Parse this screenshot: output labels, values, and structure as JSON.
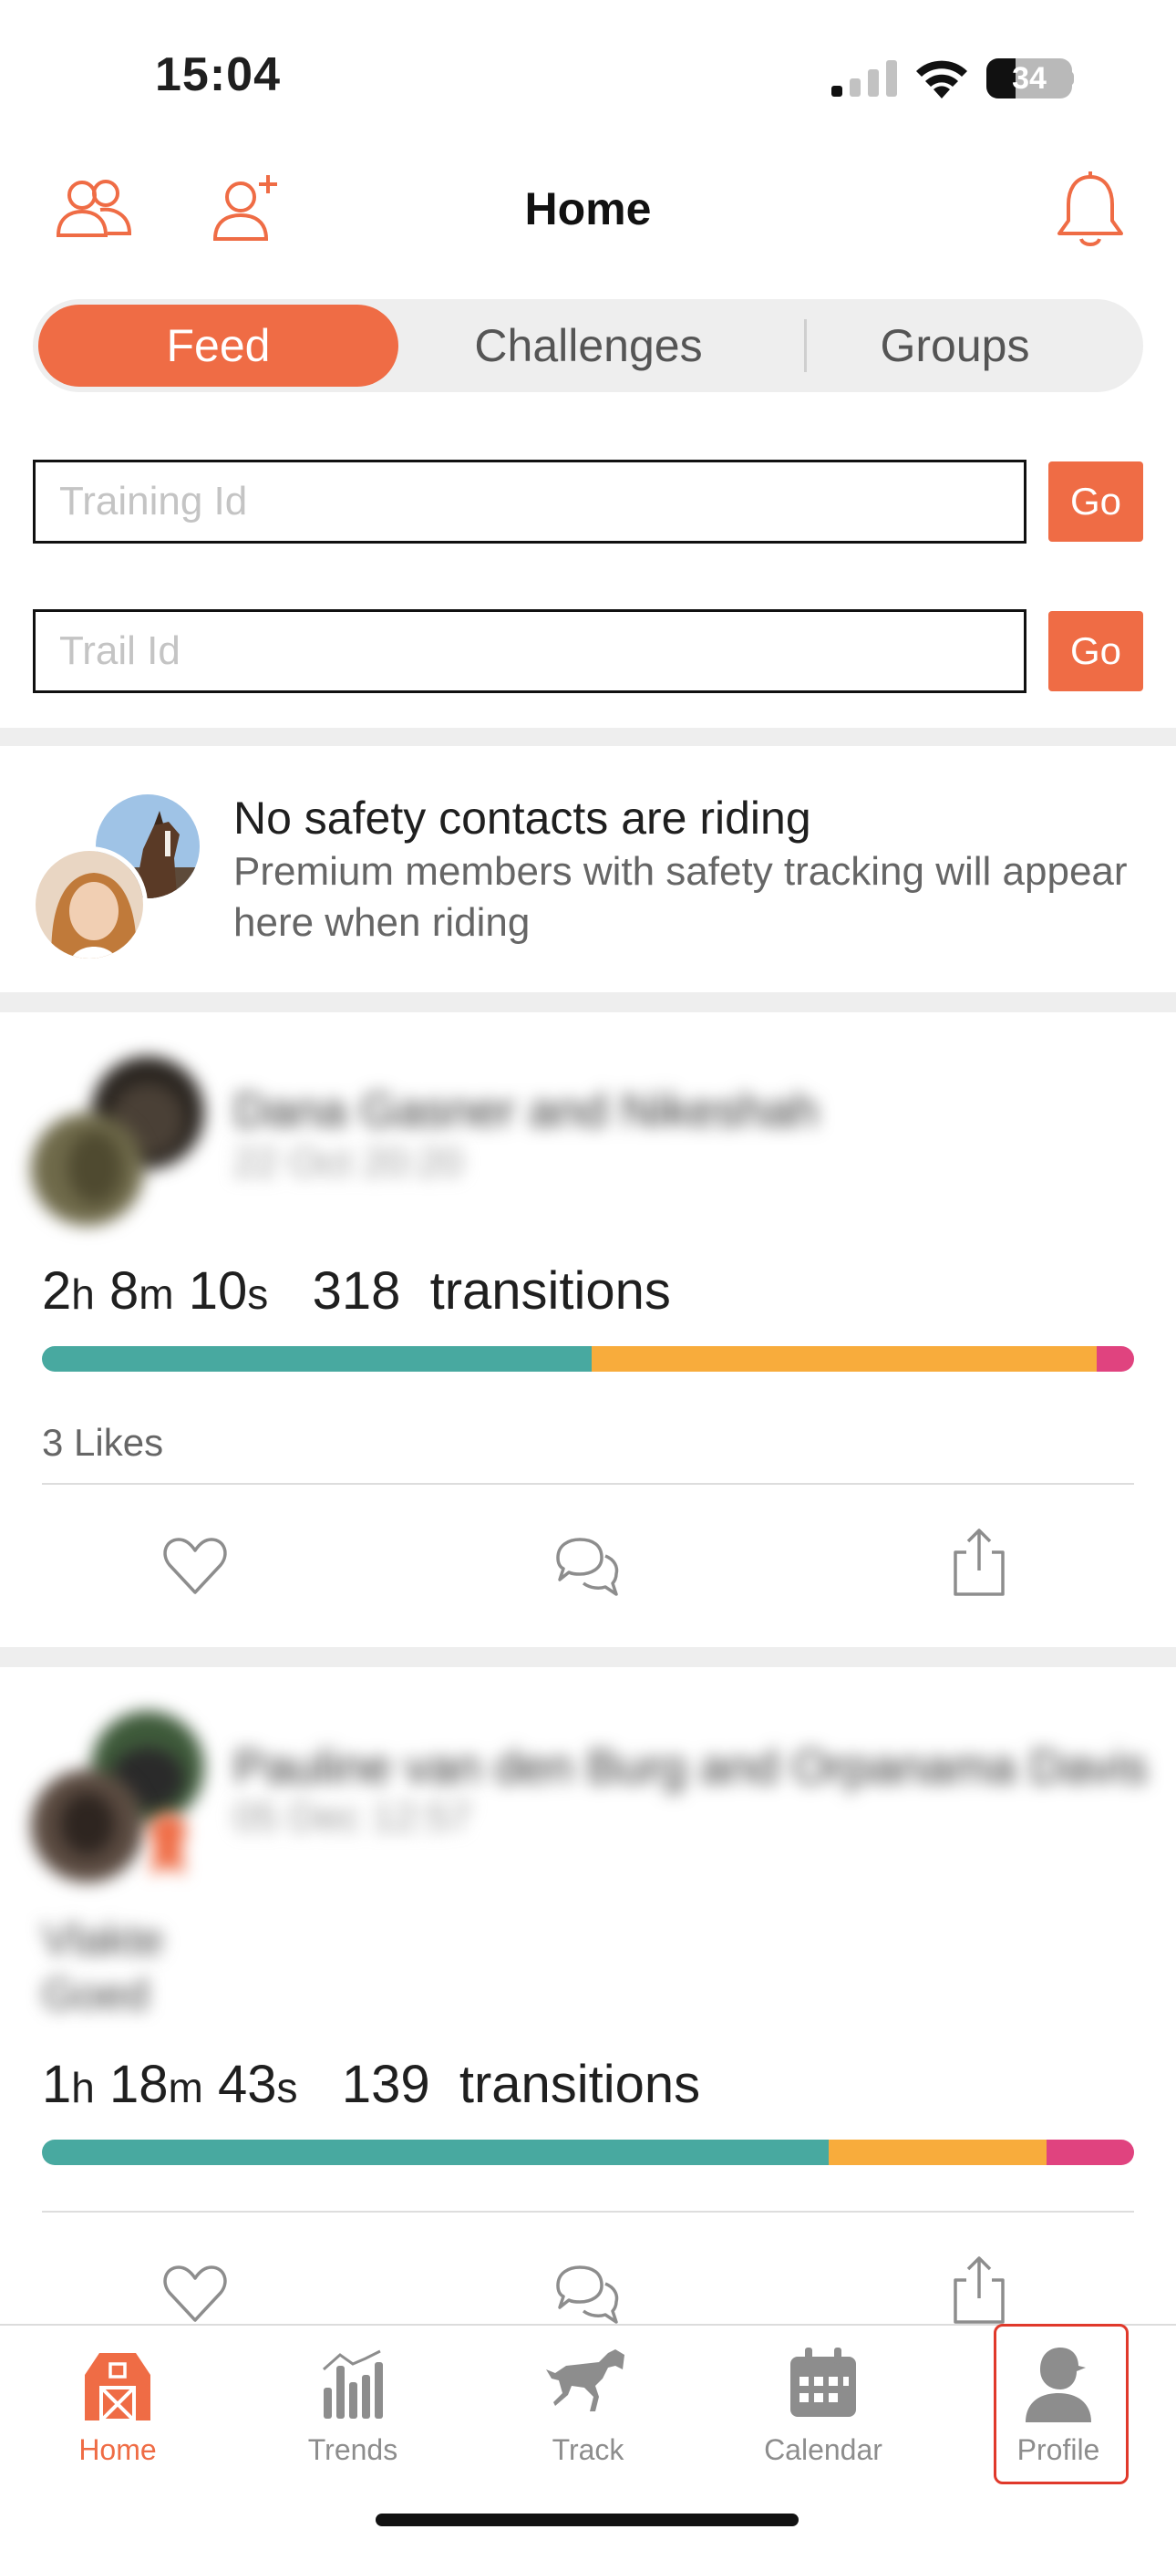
{
  "status": {
    "time": "15:04",
    "battery": "34"
  },
  "header": {
    "title": "Home"
  },
  "tabs": {
    "feed": "Feed",
    "challenges": "Challenges",
    "groups": "Groups"
  },
  "search": {
    "training_placeholder": "Training Id",
    "trail_placeholder": "Trail Id",
    "go_label": "Go"
  },
  "safety": {
    "title": "No safety contacts are riding",
    "subtitle": "Premium members with safety tracking will appear here when riding"
  },
  "feed": [
    {
      "name": "Dana Gasner and Nikeshah",
      "date": "22 Oct 20:20",
      "hours": "2",
      "minutes": "8",
      "seconds": "10",
      "transitions": "318",
      "transitions_label": "transitions",
      "gaits": [
        0.503,
        0.463,
        0.034
      ],
      "likes": "3 Likes"
    },
    {
      "name": "Pauline van den Burg and Orpanama Davis",
      "date": "05 Dec 12:57",
      "comment": [
        "Vlakte",
        "Goed"
      ],
      "hours": "1",
      "minutes": "18",
      "seconds": "43",
      "transitions": "139",
      "transitions_label": "transitions",
      "gaits": [
        0.72,
        0.2,
        0.08
      ]
    }
  ],
  "units": {
    "h": "h",
    "m": "m",
    "s": "s"
  },
  "gait_colors": [
    "#48a9a0",
    "#f8ac3c",
    "#e0437f"
  ],
  "colors": {
    "accent": "#ef6c45"
  },
  "nav": {
    "home": "Home",
    "trends": "Trends",
    "track": "Track",
    "calendar": "Calendar",
    "profile": "Profile"
  }
}
